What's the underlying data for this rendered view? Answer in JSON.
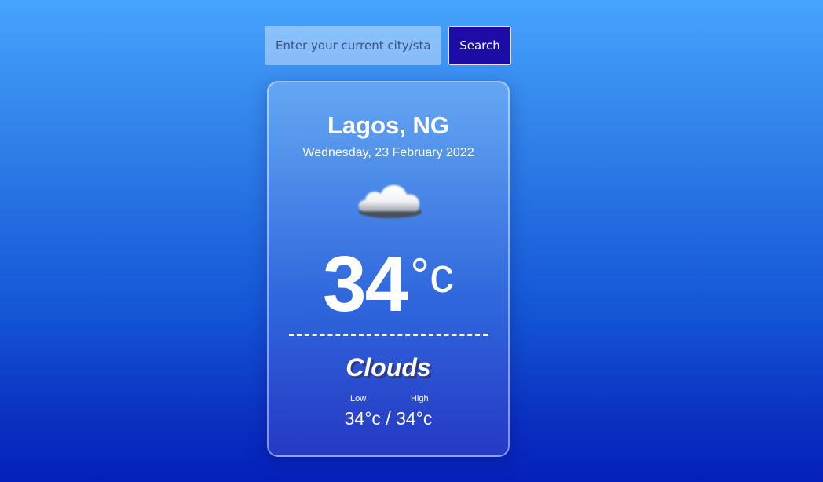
{
  "search": {
    "placeholder": "Enter your current city/state",
    "button_label": "Search"
  },
  "weather": {
    "location": "Lagos, NG",
    "date": "Wednesday, 23 February 2022",
    "icon": "cloud-icon",
    "temperature": "34",
    "unit": "°c",
    "condition": "Clouds",
    "low_label": "Low",
    "high_label": "High",
    "low_high": "34°c / 34°c"
  },
  "colors": {
    "background_top": "#47a3fc",
    "background_bottom": "#0520ba",
    "search_button": "#1b0da6",
    "text": "#ffffff",
    "condition_shadow": "#2d3a8a"
  }
}
